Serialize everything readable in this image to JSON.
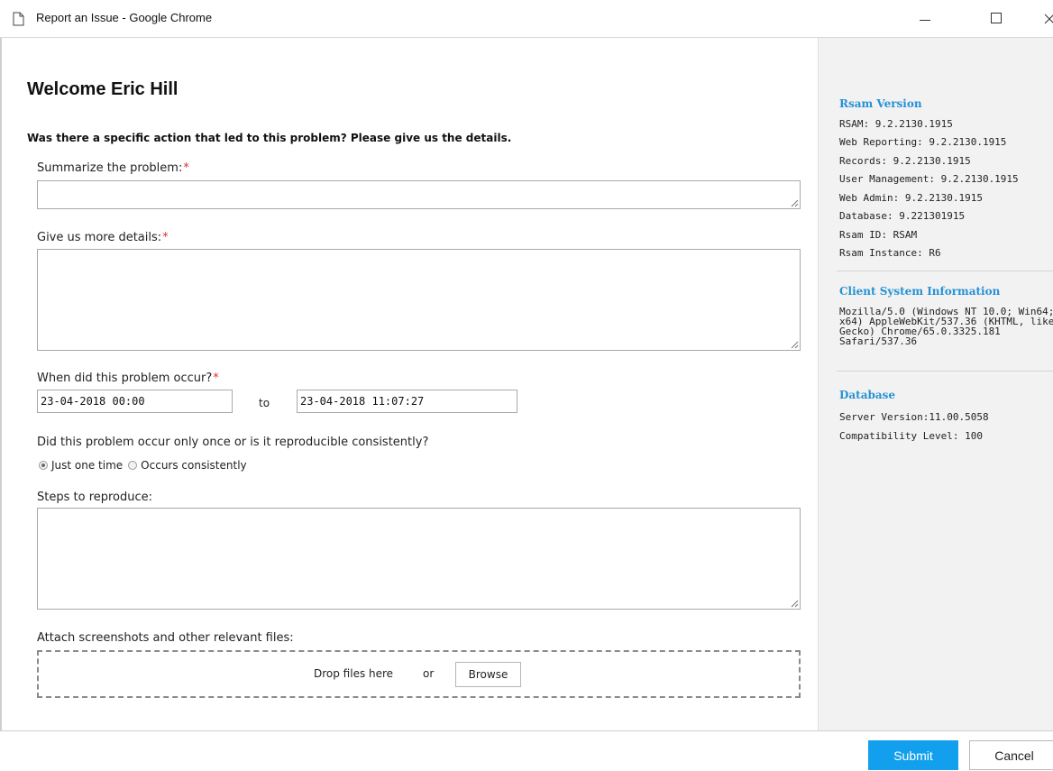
{
  "window": {
    "title": "Report an Issue - Google Chrome"
  },
  "form": {
    "welcome": "Welcome Eric Hill",
    "prompt": "Was there a specific action that led to this problem? Please give us the details.",
    "summary_label": "Summarize the problem:",
    "summary_value": "",
    "details_label": "Give us more details:",
    "details_value": "",
    "when_label": "When did this problem occur?",
    "date_from": "23-04-2018 00:00",
    "date_to_label": "to",
    "date_to": "23-04-2018 11:07:27",
    "repro_label": "Did this problem occur only once or is it reproducible consistently?",
    "repro_options": [
      {
        "label": "Just one time",
        "checked": true
      },
      {
        "label": "Occurs consistently",
        "checked": false
      }
    ],
    "steps_label": "Steps to reproduce:",
    "steps_value": "",
    "attach_label": "Attach screenshots and other relevant files:",
    "drop_text": "Drop files here",
    "or_text": "or",
    "browse_label": "Browse",
    "required_marker": "*"
  },
  "side": {
    "version_title": "Rsam Version",
    "version_lines": [
      "RSAM: 9.2.2130.1915",
      "Web Reporting: 9.2.2130.1915",
      "Records: 9.2.2130.1915",
      "User Management: 9.2.2130.1915",
      "Web Admin: 9.2.2130.1915",
      "Database: 9.221301915",
      "Rsam ID: RSAM",
      "Rsam Instance: R6"
    ],
    "client_title": "Client System Information",
    "user_agent": "Mozilla/5.0 (Windows NT 10.0; Win64; x64) AppleWebKit/537.36 (KHTML, like Gecko) Chrome/65.0.3325.181 Safari/537.36",
    "db_title": "Database",
    "db_lines": [
      "Server Version:11.00.5058",
      "Compatibility Level: 100"
    ]
  },
  "footer": {
    "submit_label": "Submit",
    "cancel_label": "Cancel"
  },
  "colors": {
    "accent": "#12a0ee",
    "heading_blue": "#2591d6",
    "required": "#e0312c"
  }
}
